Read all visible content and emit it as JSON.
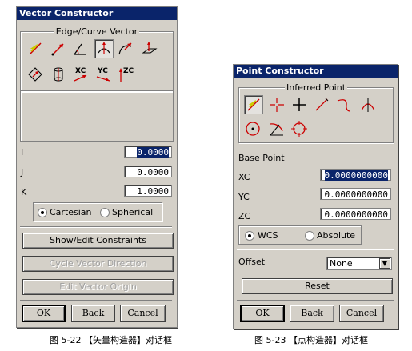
{
  "vector_dialog": {
    "title": "Vector Constructor",
    "group_title": "Edge/Curve Vector",
    "icons_row1": [
      "two-points-lightning-icon",
      "arrow-up-right-icon",
      "angle-arrow-icon",
      "tangent-vector-icon",
      "curve-vector-icon",
      "axis-plane-icon"
    ],
    "icons_row2": [
      "plane-normal-icon",
      "cylinder-axis-icon",
      "xc-axis-icon",
      "yc-axis-icon",
      "zc-axis-icon"
    ],
    "xc_label": "XC",
    "yc_label": "YC",
    "zc_label": "ZC",
    "fields": [
      {
        "label": "I",
        "value": "0.0000"
      },
      {
        "label": "J",
        "value": "0.0000"
      },
      {
        "label": "K",
        "value": "1.0000"
      }
    ],
    "radio_cartesian": "Cartesian",
    "radio_spherical": "Spherical",
    "btn_constraints": "Show/Edit Constraints",
    "btn_cycle": "Cycle Vector Direction",
    "btn_origin": "Edit Vector Origin",
    "btn_ok": "OK",
    "btn_back": "Back",
    "btn_cancel": "Cancel",
    "caption": "图 5-22  【矢量构造器】对话框"
  },
  "point_dialog": {
    "title": "Point Constructor",
    "group_title": "Inferred Point",
    "icons_row1": [
      "inferred-lightning-icon",
      "cursor-cross-icon",
      "plus-point-icon",
      "endpoint-icon",
      "control-point-icon",
      "intersection-icon"
    ],
    "icons_row2": [
      "arc-center-icon",
      "angle-on-arc-icon",
      "quadrant-point-icon"
    ],
    "base_point": "Base Point",
    "fields": [
      {
        "label": "XC",
        "value": "0.0000000000"
      },
      {
        "label": "YC",
        "value": "0.0000000000"
      },
      {
        "label": "ZC",
        "value": "0.0000000000"
      }
    ],
    "radio_wcs": "WCS",
    "radio_absolute": "Absolute",
    "offset_label": "Offset",
    "offset_value": "None",
    "btn_reset": "Reset",
    "btn_ok": "OK",
    "btn_back": "Back",
    "btn_cancel": "Cancel",
    "caption": "图 5-23  【点构造器】对话框"
  }
}
